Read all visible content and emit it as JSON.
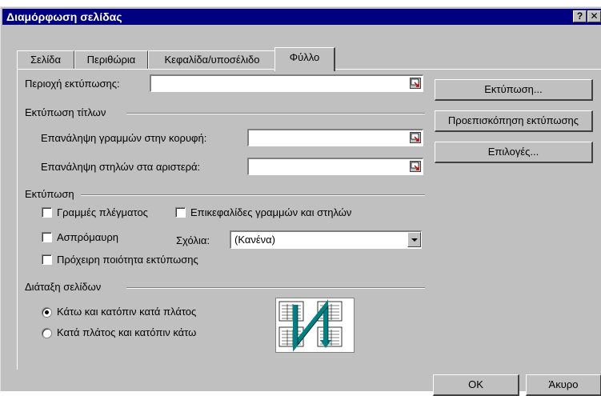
{
  "window": {
    "title": "Διαμόρφωση σελίδας",
    "help_label": "?",
    "close_label": "✕"
  },
  "tabs": [
    {
      "label": "Σελίδα",
      "active": false
    },
    {
      "label": "Περιθώρια",
      "active": false
    },
    {
      "label": "Κεφαλίδα/υποσέλιδο",
      "active": false
    },
    {
      "label": "Φύλλο",
      "active": true
    }
  ],
  "print_area": {
    "label": "Περιοχή εκτύπωσης:",
    "value": ""
  },
  "print_titles": {
    "group_label": "Εκτύπωση τίτλων",
    "rows_label": "Επανάληψη γραμμών στην κορυφή:",
    "rows_value": "",
    "cols_label": "Επανάληψη στηλών στα αριστερά:",
    "cols_value": ""
  },
  "print": {
    "group_label": "Εκτύπωση",
    "gridlines_label": "Γραμμές πλέγματος",
    "gridlines_checked": false,
    "headings_label": "Επικεφαλίδες γραμμών και στηλών",
    "headings_checked": false,
    "bw_label": "Ασπρόμαυρη",
    "bw_checked": false,
    "comments_label": "Σχόλια:",
    "comments_value": "(Κανένα)",
    "draft_label": "Πρόχειρη ποιότητα εκτύπωσης",
    "draft_checked": false
  },
  "page_order": {
    "group_label": "Διάταξη σελίδων",
    "down_then_over": "Κάτω και κατόπιν κατά πλάτος",
    "over_then_down": "Κατά πλάτος και κατόπιν κάτω",
    "selected": "down_then_over"
  },
  "side_buttons": {
    "print": "Εκτύπωση...",
    "preview": "Προεπισκόπηση εκτύπωσης",
    "options": "Επιλογές..."
  },
  "footer_buttons": {
    "ok": "OK",
    "cancel": "Άκυρο"
  },
  "colors": {
    "titlebar": "#000080",
    "face": "#c0c0c0",
    "preview_arrow": "#008080"
  }
}
